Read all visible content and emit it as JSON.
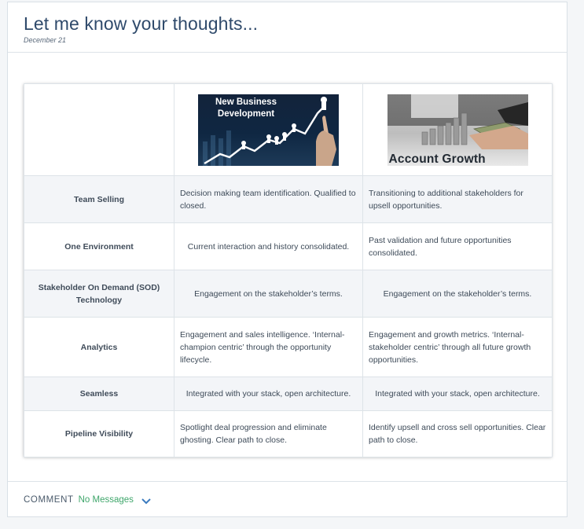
{
  "post": {
    "title": "Let me know your thoughts...",
    "date": "December 21"
  },
  "table": {
    "header_images": [
      {
        "caption": "New Business Development",
        "icon": "growth-chart-image"
      },
      {
        "caption": "Account Growth",
        "icon": "coin-stacks-image"
      }
    ],
    "rows": [
      {
        "label": "Team Selling",
        "col1": "Decision making team identification. Qualified to closed.",
        "col2": "Transitioning to additional stakeholders for upsell opportunities."
      },
      {
        "label": "One Environment",
        "col1": "Current interaction and history consolidated.",
        "col2": "Past validation and future opportunities consolidated."
      },
      {
        "label": "Stakeholder On Demand (SOD) Technology",
        "col1": "Engagement on the stakeholder’s terms.",
        "col2": "Engagement on the stakeholder’s terms."
      },
      {
        "label": "Analytics",
        "col1": "Engagement and sales intelligence. ‘Internal-champion centric’ through the opportunity lifecycle.",
        "col2": "Engagement and growth metrics. ‘Internal-stakeholder centric’ through all future growth opportunities."
      },
      {
        "label": "Seamless",
        "col1": "Integrated with your stack, open architecture.",
        "col2": "Integrated with your stack, open architecture."
      },
      {
        "label": "Pipeline Visibility",
        "col1": "Spotlight deal progression and eliminate ghosting. Clear path to close.",
        "col2": "Identify upsell and cross sell opportunities. Clear path to close."
      }
    ]
  },
  "footer": {
    "comment_label": "COMMENT",
    "comment_count": "No Messages",
    "expand_icon": "chevron-down-icon"
  },
  "colors": {
    "title": "#2f4a6b",
    "accent_green": "#3fa66b",
    "chevron": "#3b7bbf"
  }
}
